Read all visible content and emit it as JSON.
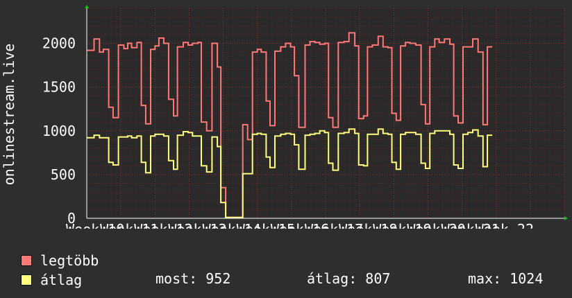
{
  "chart_data": {
    "type": "line",
    "ylabel": "onlinestream.live",
    "ylim": [
      0,
      2400
    ],
    "yticks": [
      0,
      500,
      1000,
      1500,
      2000
    ],
    "xlim": [
      0,
      98
    ],
    "xtick_labels": [
      "Week 10",
      "Week 11",
      "Week 12",
      "Week 13",
      "Week 14",
      "Week 15",
      "Week 16",
      "Week 17",
      "Week 18",
      "Week 19",
      "Week 20",
      "Week 21",
      "Week 22"
    ],
    "grid": true,
    "legend_position": "bottom-left",
    "series": [
      {
        "name": "legtöbb",
        "color": "#ff7878",
        "values": [
          1920,
          2050,
          1900,
          1930,
          1270,
          1150,
          1980,
          1940,
          2000,
          1950,
          2010,
          1290,
          1080,
          1930,
          1970,
          2060,
          2000,
          1360,
          1170,
          1960,
          2010,
          1980,
          2000,
          2010,
          1100,
          1000,
          2000,
          1730,
          350,
          10,
          10,
          10,
          1070,
          900,
          1900,
          1930,
          1900,
          1340,
          1060,
          1910,
          1960,
          2000,
          1960,
          1630,
          1040,
          1980,
          2020,
          2010,
          1990,
          2000,
          1150,
          1040,
          2010,
          2020,
          2120,
          1970,
          1140,
          1170,
          1960,
          1980,
          2080,
          1960,
          1950,
          1200,
          1120,
          1970,
          2010,
          2000,
          1980,
          1300,
          1080,
          1960,
          2050,
          2010,
          2050,
          1990,
          1170,
          1090,
          1960,
          1960,
          2050,
          1900,
          1070,
          1960
        ],
        "x": [
          0,
          1.5,
          2.6,
          3.4,
          4.5,
          5.4,
          6.5,
          7.6,
          8.4,
          9.2,
          10.3,
          11.2,
          12.1,
          13.1,
          14.0,
          14.8,
          15.8,
          16.8,
          17.8,
          18.6,
          19.8,
          20.8,
          21.7,
          22.8,
          23.5,
          24.6,
          25.7,
          26.8,
          27.5,
          28.5,
          30.0,
          31.0,
          32.0,
          33.0,
          34.0,
          35.0,
          35.8,
          36.8,
          37.6,
          38.6,
          39.8,
          40.8,
          41.8,
          42.6,
          43.5,
          44.8,
          45.8,
          46.8,
          47.8,
          48.8,
          49.6,
          50.5,
          51.6,
          52.8,
          53.8,
          55.0,
          55.8,
          56.8,
          57.6,
          58.6,
          59.8,
          60.8,
          61.8,
          62.6,
          63.5,
          64.4,
          65.4,
          66.3,
          67.5,
          68.6,
          69.5,
          70.4,
          71.4,
          72.3,
          73.4,
          74.5,
          75.3,
          76.2,
          77.2,
          78.2,
          79.2,
          80.3,
          81.3,
          82.2
        ]
      },
      {
        "name": "átlag",
        "color": "#ffff80",
        "values": [
          920,
          950,
          920,
          920,
          640,
          610,
          930,
          930,
          940,
          920,
          940,
          640,
          520,
          940,
          960,
          960,
          940,
          660,
          560,
          950,
          990,
          980,
          940,
          940,
          600,
          530,
          930,
          820,
          180,
          10,
          10,
          10,
          510,
          510,
          960,
          970,
          960,
          700,
          580,
          940,
          960,
          970,
          960,
          840,
          560,
          950,
          960,
          970,
          1000,
          980,
          630,
          550,
          970,
          980,
          1020,
          970,
          610,
          600,
          960,
          960,
          1020,
          970,
          960,
          640,
          560,
          960,
          980,
          980,
          960,
          630,
          570,
          970,
          1000,
          1000,
          1000,
          960,
          610,
          570,
          960,
          980,
          1010,
          940,
          590,
          950
        ],
        "x": [
          0,
          1.5,
          2.6,
          3.4,
          4.5,
          5.4,
          6.5,
          7.6,
          8.4,
          9.2,
          10.3,
          11.2,
          12.1,
          13.1,
          14.0,
          14.8,
          15.8,
          16.8,
          17.8,
          18.6,
          19.8,
          20.8,
          21.7,
          22.8,
          23.5,
          24.6,
          25.7,
          26.8,
          27.5,
          28.5,
          30.0,
          31.0,
          32.0,
          33.0,
          34.0,
          35.0,
          35.8,
          36.8,
          37.6,
          38.6,
          39.8,
          40.8,
          41.8,
          42.6,
          43.5,
          44.8,
          45.8,
          46.8,
          47.8,
          48.8,
          49.6,
          50.5,
          51.6,
          52.8,
          53.8,
          55.0,
          55.8,
          56.8,
          57.6,
          58.6,
          59.8,
          60.8,
          61.8,
          62.6,
          63.5,
          64.4,
          65.4,
          66.3,
          67.5,
          68.6,
          69.5,
          70.4,
          71.4,
          72.3,
          73.4,
          74.5,
          75.3,
          76.2,
          77.2,
          78.2,
          79.2,
          80.3,
          81.3,
          82.2
        ]
      }
    ]
  },
  "colors": {
    "background": "#2e2e2e",
    "plot_background": "#2a2a2a",
    "grid": "#6a2a2a",
    "axis": "#ffffff",
    "arrow": "#00cc00"
  },
  "legend": [
    {
      "label": "legtöbb",
      "color": "#ff7878"
    },
    {
      "label": "átlag",
      "color": "#ffff80"
    }
  ],
  "stats": {
    "now": "most: 952",
    "avg": "átlag: 807",
    "max": "max: 1024"
  }
}
